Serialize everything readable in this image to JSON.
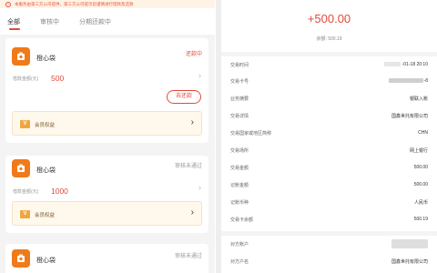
{
  "notice": {
    "text": "本服务由第三方公司提供，第三方公司提示您谨慎进行借款及还款",
    "icon": "info-icon"
  },
  "tabs": [
    {
      "label": "全部"
    },
    {
      "label": "审核中"
    },
    {
      "label": "分期还款中"
    }
  ],
  "loans": [
    {
      "name": "橙心袋",
      "status": "还款中",
      "amount_label": "借款金额(元)",
      "amount": "500",
      "repay_button": "去还款",
      "member_label": "会员权益"
    },
    {
      "name": "橙心袋",
      "status": "审核未通过",
      "amount_label": "借款金额(元)",
      "amount": "1000",
      "member_label": "会员权益"
    },
    {
      "name": "橙心袋",
      "status": "审核未通过"
    }
  ],
  "detail": {
    "amount": "+500.00",
    "balance": "余额: 500.19",
    "rows": [
      {
        "label": "交易时间",
        "value": "-01-18  20:10"
      },
      {
        "label": "交易卡号",
        "value": "-8"
      },
      {
        "label": "业务摘要",
        "value": "银联入账"
      },
      {
        "label": "交易详情",
        "value": "国鑫世托有限公司"
      },
      {
        "label": "交易国家或地区简称",
        "value": "CHN"
      },
      {
        "label": "交易场所",
        "value": "网上银行"
      },
      {
        "label": "交易金额",
        "value": "500.00"
      },
      {
        "label": "记账金额",
        "value": "500.00"
      },
      {
        "label": "记账币种",
        "value": "人民币"
      },
      {
        "label": "交易卡余额",
        "value": "500.19"
      }
    ],
    "counterparty": [
      {
        "label": "对方账户",
        "value": ""
      },
      {
        "label": "对方户名",
        "value": "国鑫世托有限公司"
      }
    ]
  },
  "colors": {
    "accent": "#e04a3b",
    "brand": "#f07a19",
    "member_bg": "#fff8ec"
  }
}
